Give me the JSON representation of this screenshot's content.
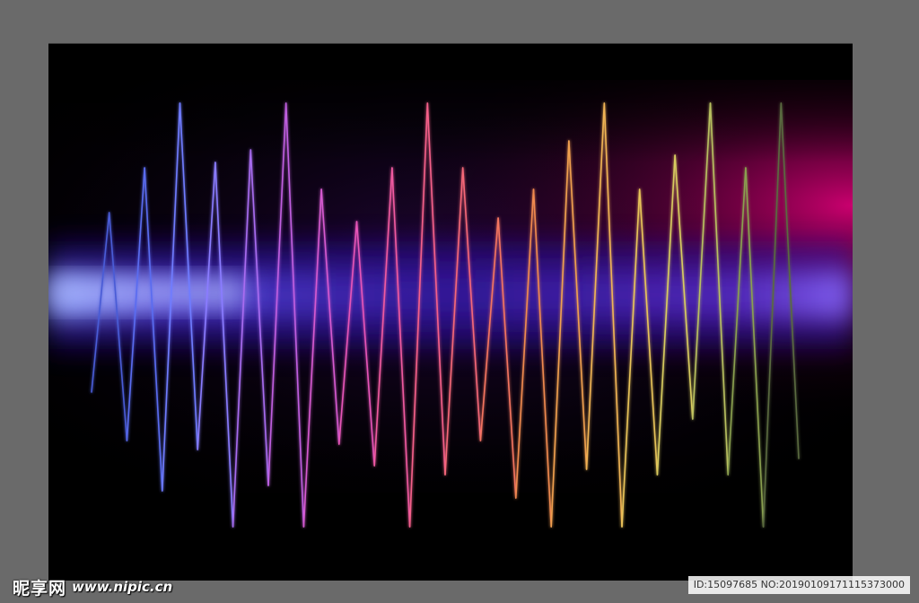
{
  "watermark": {
    "logo_text": "昵享网",
    "url": "www.nipic.cn",
    "id_text": "ID:15097685 NO:20190109171115373000"
  },
  "artwork": {
    "description_icon": "sound-wave-image",
    "background_color": "#000000",
    "glow_colors": [
      "#7a8cff",
      "#4b22c8",
      "#c8006e"
    ],
    "waveform": {
      "peaks": [
        236,
        186,
        114,
        180,
        166,
        114,
        210,
        246,
        186,
        114,
        186,
        242,
        210,
        156,
        114,
        210,
        172,
        114,
        186,
        114
      ],
      "troughs": [
        436,
        490,
        546,
        500,
        586,
        540,
        586,
        494,
        518,
        586,
        528,
        490,
        554,
        586,
        522,
        586,
        528,
        466,
        528,
        586,
        510
      ],
      "colors": [
        "#4a5bd6",
        "#5a6cf0",
        "#6f7cff",
        "#8a7bff",
        "#a86cf0",
        "#c05fe0",
        "#d65ad0",
        "#e655b8",
        "#f05aa0",
        "#f5608a",
        "#f56878",
        "#f47560",
        "#f08a50",
        "#f0a050",
        "#f0b455",
        "#e8c45a",
        "#d8cc60",
        "#b8c060",
        "#8aa050",
        "#5a6a40"
      ]
    }
  }
}
